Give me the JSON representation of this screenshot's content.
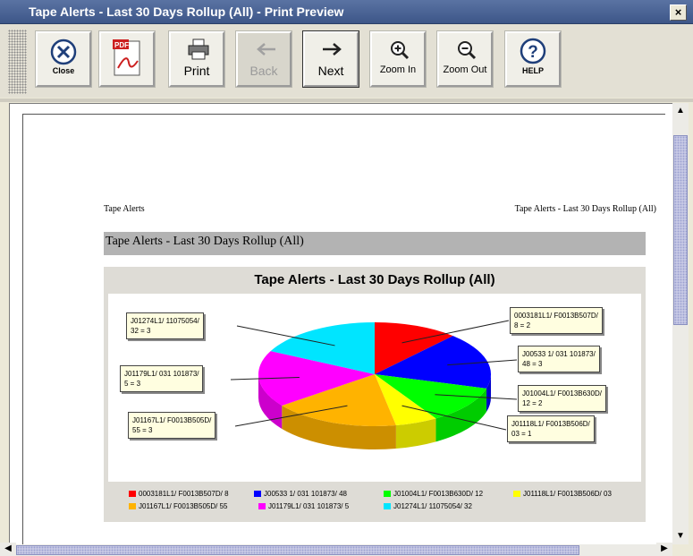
{
  "window": {
    "title": "Tape Alerts - Last 30 Days Rollup (All) - Print Preview",
    "close_glyph": "×"
  },
  "toolbar": {
    "close_label": "Close",
    "pdf_label": "PDF",
    "print_label": "Print",
    "back_label": "Back",
    "next_label": "Next",
    "zoom_in_label": "Zoom In",
    "zoom_out_label": "Zoom Out",
    "help_label": "HELP"
  },
  "report": {
    "header_left": "Tape Alerts",
    "header_right": "Tape Alerts - Last 30 Days Rollup (All)",
    "section_title": "Tape Alerts - Last 30 Days Rollup (All)"
  },
  "chart_data": {
    "type": "pie",
    "title": "Tape Alerts - Last 30 Days Rollup (All)",
    "legend_position": "bottom",
    "callouts": [
      {
        "text": "0003181L1/ F0013B507D/\n8 = 2"
      },
      {
        "text": "J00533 1/ 031 101873/\n48 = 3"
      },
      {
        "text": "J01004L1/ F0013B630D/\n12 = 2"
      },
      {
        "text": "J01118L1/ F0013B506D/\n03 = 1"
      },
      {
        "text": "J01167L1/ F0013B505D/\n55 = 3"
      },
      {
        "text": "J01179L1/ 031 101873/\n5 = 3"
      },
      {
        "text": "J01274L1/ 11075054/\n32 = 3"
      }
    ],
    "slices": [
      {
        "name": "0003181L1/ F0013B507D/ 8",
        "value": 2,
        "color": "#ff0000"
      },
      {
        "name": "J00533 1/ 031 101873/ 48",
        "value": 3,
        "color": "#0000ff"
      },
      {
        "name": "J01004L1/ F0013B630D/ 12",
        "value": 2,
        "color": "#00ff00"
      },
      {
        "name": "J01118L1/ F0013B506D/ 03",
        "value": 1,
        "color": "#ffff00"
      },
      {
        "name": "J01167L1/ F0013B505D/ 55",
        "value": 3,
        "color": "#ffb300"
      },
      {
        "name": "J01179L1/ 031 101873/ 5",
        "value": 3,
        "color": "#ff00ff"
      },
      {
        "name": "J01274L1/ 11075054/ 32",
        "value": 3,
        "color": "#00e5ff"
      }
    ]
  }
}
